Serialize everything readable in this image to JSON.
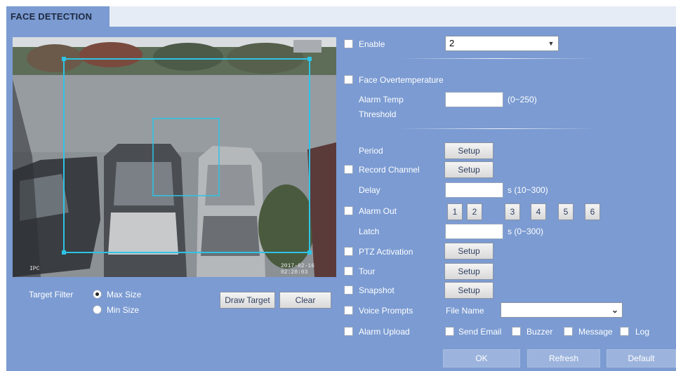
{
  "tab": {
    "title": "FACE DETECTION"
  },
  "video": {
    "overlay_left": "IPC",
    "overlay_right": "2017-02-16 02:28:03"
  },
  "target_filter": {
    "label": "Target Filter",
    "max_size": "Max Size",
    "min_size": "Min Size",
    "selected": "Max Size"
  },
  "buttons": {
    "draw_target": "Draw Target",
    "clear": "Clear",
    "ok": "OK",
    "refresh": "Refresh",
    "default": "Default"
  },
  "enable": {
    "label": "Enable",
    "value": "2"
  },
  "face_overtemp": {
    "label": "Face Overtemperature",
    "alarm_temp_label_1": "Alarm Temp",
    "alarm_temp_label_2": "Threshold",
    "alarm_temp_value": "",
    "range": "(0~250)"
  },
  "period": {
    "label": "Period",
    "button": "Setup"
  },
  "record_channel": {
    "label": "Record Channel",
    "button": "Setup"
  },
  "delay": {
    "label": "Delay",
    "value": "",
    "unit": "s (10~300)"
  },
  "alarm_out": {
    "label": "Alarm Out",
    "channels": [
      "1",
      "2",
      "3",
      "4",
      "5",
      "6"
    ]
  },
  "latch": {
    "label": "Latch",
    "value": "",
    "unit": "s (0~300)"
  },
  "ptz_activation": {
    "label": "PTZ Activation",
    "button": "Setup"
  },
  "tour": {
    "label": "Tour",
    "button": "Setup"
  },
  "snapshot": {
    "label": "Snapshot",
    "button": "Setup"
  },
  "voice_prompts": {
    "label": "Voice Prompts",
    "file_name_label": "File Name",
    "file_name_value": ""
  },
  "alarm_upload": {
    "label": "Alarm Upload",
    "send_email": "Send Email",
    "buzzer": "Buzzer",
    "message": "Message",
    "log": "Log"
  },
  "colors": {
    "panel": "#7b9bd2",
    "tab": "#7b9bd2",
    "detect_box": "#2ec4e6"
  }
}
